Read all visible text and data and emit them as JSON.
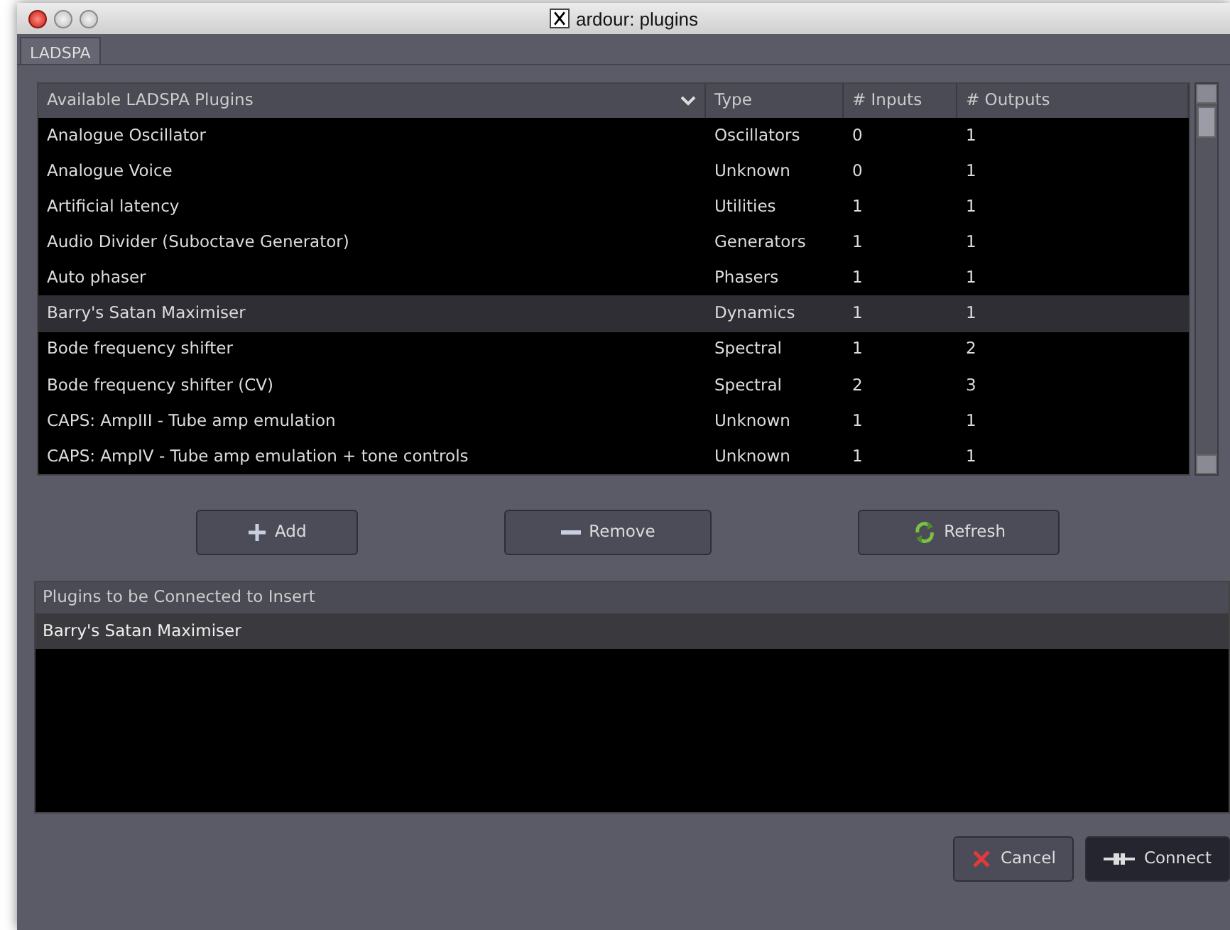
{
  "window": {
    "title": "ardour: plugins"
  },
  "tabs": [
    {
      "label": "LADSPA",
      "selected": true
    }
  ],
  "plugin_table": {
    "columns": [
      "Available LADSPA Plugins",
      "Type",
      "# Inputs",
      "# Outputs"
    ],
    "rows": [
      {
        "name": "Analogue Oscillator",
        "type": "Oscillators",
        "inputs": "0",
        "outputs": "1",
        "selected": false
      },
      {
        "name": "Analogue Voice",
        "type": "Unknown",
        "inputs": "0",
        "outputs": "1",
        "selected": false
      },
      {
        "name": "Artificial latency",
        "type": "Utilities",
        "inputs": "1",
        "outputs": "1",
        "selected": false
      },
      {
        "name": "Audio Divider (Suboctave Generator)",
        "type": "Generators",
        "inputs": "1",
        "outputs": "1",
        "selected": false
      },
      {
        "name": "Auto phaser",
        "type": "Phasers",
        "inputs": "1",
        "outputs": "1",
        "selected": false
      },
      {
        "name": "Barry's Satan Maximiser",
        "type": "Dynamics",
        "inputs": "1",
        "outputs": "1",
        "selected": true
      },
      {
        "name": "Bode frequency shifter",
        "type": "Spectral",
        "inputs": "1",
        "outputs": "2",
        "selected": false
      },
      {
        "name": "Bode frequency shifter (CV)",
        "type": "Spectral",
        "inputs": "2",
        "outputs": "3",
        "selected": false
      },
      {
        "name": "CAPS: AmpIII - Tube amp emulation",
        "type": "Unknown",
        "inputs": "1",
        "outputs": "1",
        "selected": false
      },
      {
        "name": "CAPS: AmpIV - Tube amp emulation + tone controls",
        "type": "Unknown",
        "inputs": "1",
        "outputs": "1",
        "selected": false
      }
    ]
  },
  "action_buttons": [
    {
      "label": "Add",
      "kind": "add"
    },
    {
      "label": "Remove",
      "kind": "remove"
    },
    {
      "label": "Refresh",
      "kind": "refresh"
    }
  ],
  "insert_list": {
    "title": "Plugins to be Connected to Insert",
    "rows": [
      {
        "name": "Barry's Satan Maximiser",
        "selected": true
      }
    ]
  },
  "dialog_buttons": [
    {
      "label": "Cancel",
      "kind": "cancel"
    },
    {
      "label": "Connect",
      "kind": "connect"
    }
  ]
}
